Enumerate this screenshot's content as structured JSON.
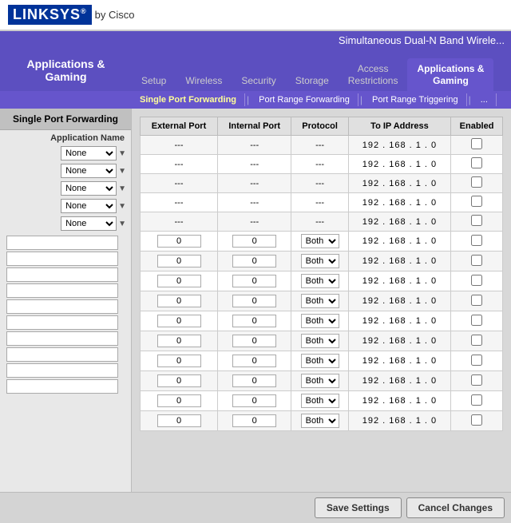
{
  "header": {
    "logo_linksys": "LINKSYS",
    "logo_reg": "®",
    "logo_cisco": "by Cisco"
  },
  "top_nav": {
    "title": "Simultaneous Dual-N Band Wirele..."
  },
  "side_panel": {
    "title": "Applications & Gaming"
  },
  "nav_tabs": [
    {
      "label": "Setup",
      "active": false
    },
    {
      "label": "Wireless",
      "active": false
    },
    {
      "label": "Security",
      "active": false
    },
    {
      "label": "Storage",
      "active": false
    },
    {
      "label": "Access Restrictions",
      "active": false
    },
    {
      "label": "Applications & Gaming",
      "active": true
    }
  ],
  "sub_nav": [
    {
      "label": "Single Port Forwarding",
      "active": true
    },
    {
      "label": "Port Range Forwarding",
      "active": false
    },
    {
      "label": "Port Range Triggering",
      "active": false
    },
    {
      "label": "...",
      "active": false
    }
  ],
  "sidebar": {
    "title": "Single Port Forwarding",
    "col_label": "Application Name",
    "rows": [
      {
        "select": "None"
      },
      {
        "select": "None"
      },
      {
        "select": "None"
      },
      {
        "select": "None"
      },
      {
        "select": "None"
      }
    ],
    "extra_inputs": [
      "",
      "",
      "",
      "",
      "",
      "",
      "",
      "",
      "",
      ""
    ]
  },
  "table": {
    "headers": [
      "External Port",
      "Internal Port",
      "Protocol",
      "To IP Address",
      "Enabled"
    ],
    "rows": [
      {
        "ext": "---",
        "int": "---",
        "proto": "---",
        "ip": "192 . 168 . 1 . 0",
        "enabled": false,
        "type": "none"
      },
      {
        "ext": "---",
        "int": "---",
        "proto": "---",
        "ip": "192 . 168 . 1 . 0",
        "enabled": false,
        "type": "none"
      },
      {
        "ext": "---",
        "int": "---",
        "proto": "---",
        "ip": "192 . 168 . 1 . 0",
        "enabled": false,
        "type": "none"
      },
      {
        "ext": "---",
        "int": "---",
        "proto": "---",
        "ip": "192 . 168 . 1 . 0",
        "enabled": false,
        "type": "none"
      },
      {
        "ext": "---",
        "int": "---",
        "proto": "---",
        "ip": "192 . 168 . 1 . 0",
        "enabled": false,
        "type": "none"
      },
      {
        "ext": "0",
        "int": "0",
        "proto": "Both",
        "ip": "192 . 168 . 1 . 0",
        "enabled": false,
        "type": "both"
      },
      {
        "ext": "0",
        "int": "0",
        "proto": "Both",
        "ip": "192 . 168 . 1 . 0",
        "enabled": false,
        "type": "both"
      },
      {
        "ext": "0",
        "int": "0",
        "proto": "Both",
        "ip": "192 . 168 . 1 . 0",
        "enabled": false,
        "type": "both"
      },
      {
        "ext": "0",
        "int": "0",
        "proto": "Both",
        "ip": "192 . 168 . 1 . 0",
        "enabled": false,
        "type": "both"
      },
      {
        "ext": "0",
        "int": "0",
        "proto": "Both",
        "ip": "192 . 168 . 1 . 0",
        "enabled": false,
        "type": "both"
      },
      {
        "ext": "0",
        "int": "0",
        "proto": "Both",
        "ip": "192 . 168 . 1 . 0",
        "enabled": false,
        "type": "both"
      },
      {
        "ext": "0",
        "int": "0",
        "proto": "Both",
        "ip": "192 . 168 . 1 . 0",
        "enabled": false,
        "type": "both"
      },
      {
        "ext": "0",
        "int": "0",
        "proto": "Both",
        "ip": "192 . 168 . 1 . 0",
        "enabled": false,
        "type": "both"
      },
      {
        "ext": "0",
        "int": "0",
        "proto": "Both",
        "ip": "192 . 168 . 1 . 0",
        "enabled": false,
        "type": "both"
      },
      {
        "ext": "0",
        "int": "0",
        "proto": "Both",
        "ip": "192 . 168 . 1 . 0",
        "enabled": false,
        "type": "both"
      }
    ]
  },
  "footer": {
    "save_label": "Save Settings",
    "cancel_label": "Cancel Changes"
  }
}
